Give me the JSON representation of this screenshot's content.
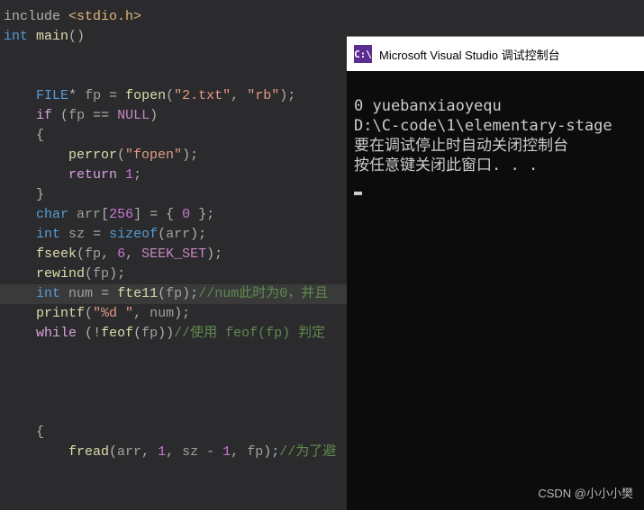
{
  "code": {
    "include_kw": "include",
    "stdio": "<stdio.h>",
    "int": "int",
    "main": "main",
    "file_t": "FILE",
    "star": "*",
    "fp": "fp",
    "eq": "=",
    "fopen": "fopen",
    "str_file": "\"2.txt\"",
    "comma": ",",
    "str_mode": "\"rb\"",
    "semi": ";",
    "if": "if",
    "eqeq": "==",
    "null": "NULL",
    "lbrace": "{",
    "rbrace": "}",
    "perror": "perror",
    "str_fopen": "\"fopen\"",
    "return": "return",
    "one": "1",
    "char": "char",
    "arr": "arr",
    "a256": "256",
    "arr_init": "= { 0 }",
    "zero": "0",
    "sz": "sz",
    "sizeof": "sizeof",
    "fseek": "fseek",
    "six": "6",
    "seek_set": "SEEK_SET",
    "rewind": "rewind",
    "num": "num",
    "ftell": "fte11",
    "cmt_num": "//num此时为0，并且",
    "printf": "printf",
    "str_fmt": "\"%d \"",
    "while": "while",
    "feof": "feof",
    "bang": "!",
    "cmt_feof": "//使用 feof(fp) 判定",
    "fread": "fread",
    "minus": "-",
    "cmt_fread": "//为了避"
  },
  "console": {
    "title": "Microsoft Visual Studio 调试控制台",
    "icon_text": "C:\\",
    "line1": "0 yuebanxiaoyequ",
    "line2": "D:\\C-code\\1\\elementary-stage",
    "line3": "要在调试停止时自动关闭控制台",
    "line4": "按任意键关闭此窗口. . ."
  },
  "watermark": "CSDN @小小小樊"
}
